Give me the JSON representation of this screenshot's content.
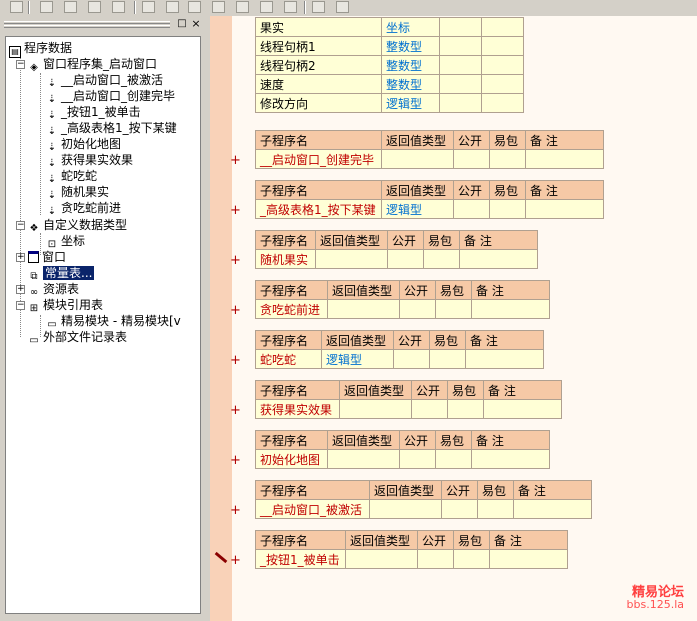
{
  "var_table": [
    {
      "name": "果实",
      "type": "坐标"
    },
    {
      "name": "线程句柄1",
      "type": "整数型"
    },
    {
      "name": "线程句柄2",
      "type": "整数型"
    },
    {
      "name": "速度",
      "type": "整数型"
    },
    {
      "name": "修改方向",
      "type": "逻辑型"
    }
  ],
  "sub_headers": {
    "name": "子程序名",
    "ret": "返回值类型",
    "public": "公开",
    "easy": "易包",
    "note": "备 注"
  },
  "subs": [
    {
      "name": "__启动窗口_创建完毕",
      "ret": ""
    },
    {
      "name": "_高级表格1_按下某键",
      "ret": "逻辑型"
    },
    {
      "name": "随机果实",
      "ret": ""
    },
    {
      "name": "贪吃蛇前进",
      "ret": ""
    },
    {
      "name": "蛇吃蛇",
      "ret": "逻辑型"
    },
    {
      "name": "获得果实效果",
      "ret": ""
    },
    {
      "name": "初始化地图",
      "ret": ""
    },
    {
      "name": "__启动窗口_被激活",
      "ret": ""
    },
    {
      "name": "_按钮1_被单击",
      "ret": ""
    }
  ],
  "tree": {
    "root": "程序数据",
    "assembly": "窗口程序集_启动窗口",
    "subs": [
      "__启动窗口_被激活",
      "__启动窗口_创建完毕",
      "_按钮1_被单击",
      "_高级表格1_按下某键",
      "初始化地图",
      "获得果实效果",
      "蛇吃蛇",
      "随机果实",
      "贪吃蛇前进"
    ],
    "custom_types": "自定义数据类型",
    "coord": "坐标",
    "window": "窗口",
    "constants": "常量表...",
    "resources": "资源表",
    "module_ref": "模块引用表",
    "module_item": "精易模块 - 精易模块[v",
    "external": "外部文件记录表"
  },
  "plus_symbol": "+",
  "watermark": {
    "line1": "精易论坛",
    "line2": "bbs.125.la"
  }
}
